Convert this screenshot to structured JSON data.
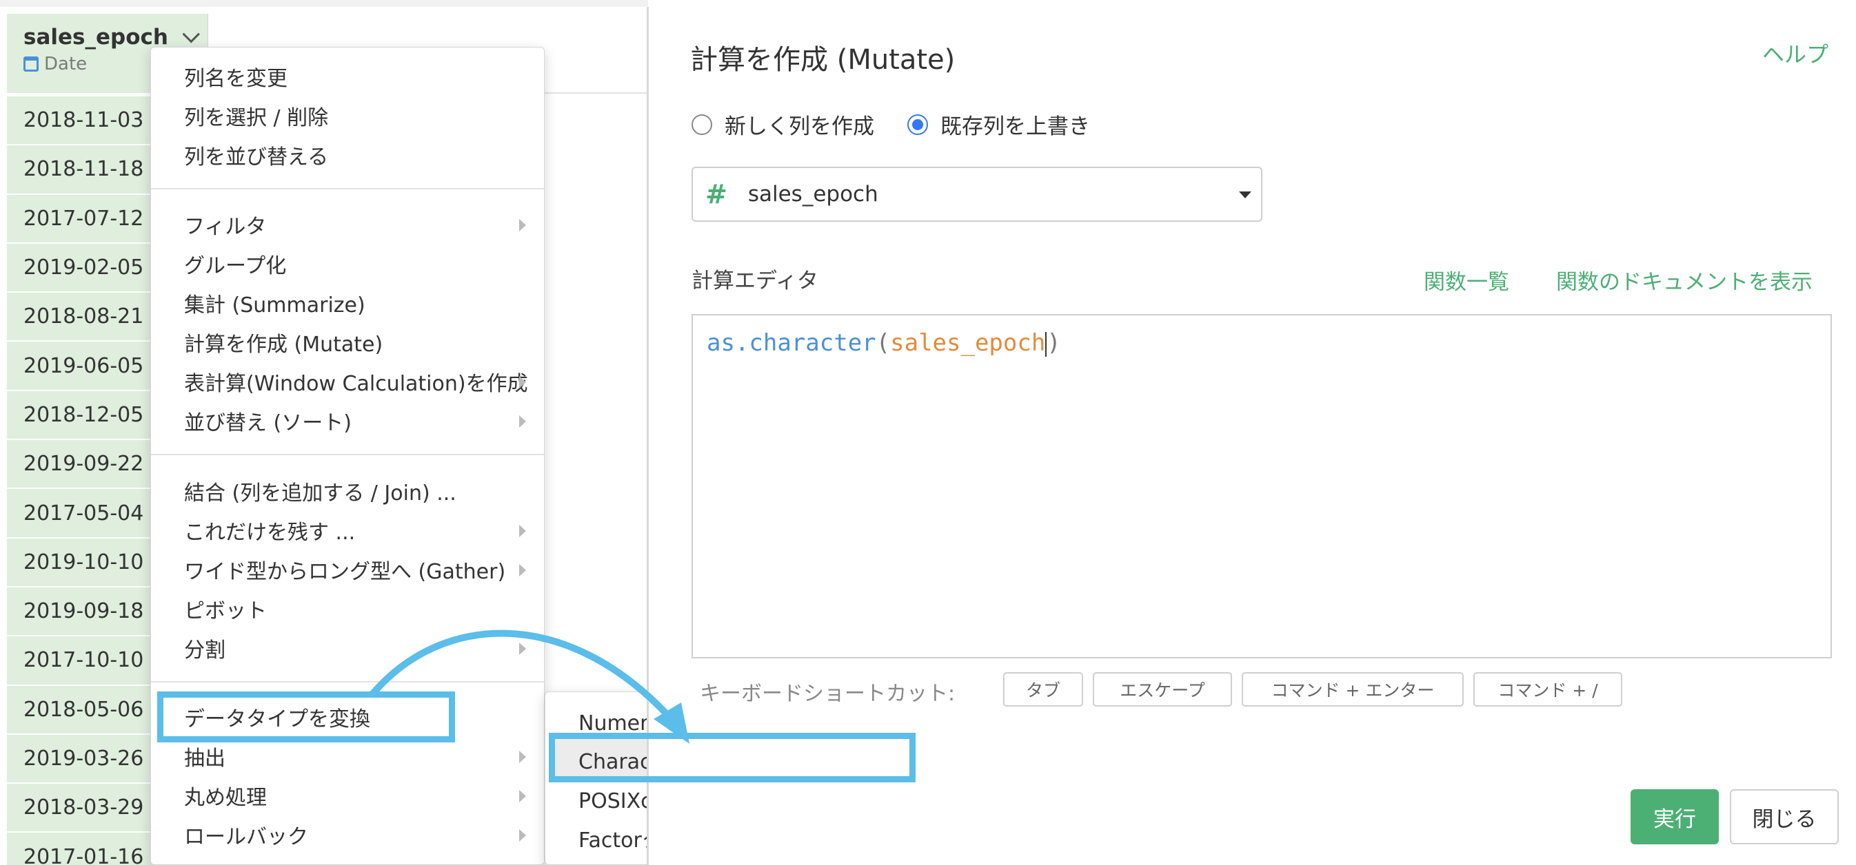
{
  "column": {
    "name": "sales_epoch",
    "type": "Date",
    "rows": [
      "2018-11-03",
      "2018-11-18",
      "2017-07-12",
      "2019-02-05",
      "2018-08-21",
      "2019-06-05",
      "2018-12-05",
      "2019-09-22",
      "2017-05-04",
      "2019-10-10",
      "2019-09-18",
      "2017-10-10",
      "2018-05-06",
      "2019-03-26",
      "2018-03-29",
      "2017-01-16"
    ]
  },
  "menu": {
    "rename": "列名を変更",
    "select": "列を選択 / 削除",
    "reorder": "列を並び替える",
    "filter": "フィルタ",
    "group": "グループ化",
    "summarize": "集計 (Summarize)",
    "mutate": "計算を作成 (Mutate)",
    "window": "表計算(Window Calculation)を作成",
    "sort": "並び替え (ソート)",
    "join": "結合 (列を追加する / Join) ...",
    "keep": "これだけを残す ...",
    "gather": "ワイド型からロング型へ (Gather)",
    "pivot": "ピボット",
    "split": "分割",
    "convert_type": "データタイプを変換",
    "extract": "抽出",
    "round": "丸め処理",
    "rollback": "ロールバック"
  },
  "submenu": {
    "numeric": "Numeric (数値) タイプに変換",
    "character": "Character (文字) タイプに変換",
    "posixct": "POSIXctタイプに変換",
    "factor": "Factorタイプに変換"
  },
  "dialog": {
    "title": "計算を作成 (Mutate)",
    "help": "ヘルプ",
    "radio_new": "新しく列を作成",
    "radio_overwrite": "既存列を上書き",
    "selected_column": "sales_epoch",
    "editor_label": "計算エディタ",
    "func_list": "関数一覧",
    "func_docs": "関数のドキュメントを表示",
    "code_fn": "as.character",
    "code_open": "(",
    "code_arg": "sales_epoch",
    "code_close": ")",
    "shortcut_label": "キーボードショートカット:",
    "kbd_tab": "タブ",
    "kbd_escape": "エスケープ",
    "kbd_cmd_enter": "コマンド + エンター",
    "kbd_cmd_slash": "コマンド + /",
    "run": "実行",
    "close": "閉じる"
  },
  "colors": {
    "accent_green": "#4caf74",
    "highlight_blue": "#5bbde9",
    "column_bg": "#dfeedd"
  }
}
